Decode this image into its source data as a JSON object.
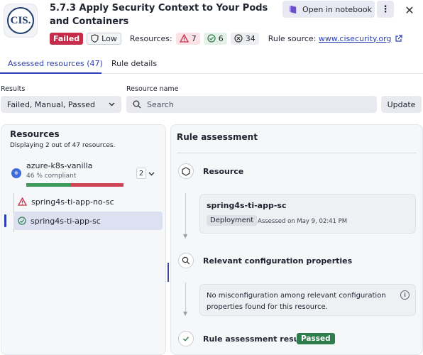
{
  "header": {
    "logo_text": "CIS.",
    "title": "5.7.3 Apply Security Context to Your Pods and Containers",
    "notebook_button": "Open in notebook",
    "more_button": "⋮",
    "close_button": "✕"
  },
  "meta": {
    "status": "Failed",
    "severity": "Low",
    "resources_label": "Resources:",
    "failed_count": "7",
    "passed_count": "6",
    "skipped_count": "34",
    "rule_source_label": "Rule source:",
    "rule_source_link": "www.cisecurity.org"
  },
  "tabs": [
    {
      "label": "Assessed resources (47)",
      "active": true
    },
    {
      "label": "Rule details",
      "active": false
    }
  ],
  "filters": {
    "results_label": "Results",
    "results_value": "Failed, Manual, Passed",
    "resource_name_label": "Resource name",
    "search_placeholder": "Search",
    "update_button": "Update"
  },
  "resources": {
    "title": "Resources",
    "subtitle": "Displaying 2 out of 47 resources.",
    "cluster": {
      "name": "azure-k8s-vanilla",
      "compliance_text": "46 % compliant",
      "compliance_fraction": 0.46,
      "count": "2"
    },
    "items": [
      {
        "name": "spring4s-ti-app-no-sc",
        "status": "failed",
        "selected": false
      },
      {
        "name": "spring4s-ti-app-sc",
        "status": "passed",
        "selected": true
      }
    ]
  },
  "assessment": {
    "title": "Rule assessment",
    "resource_step": "Resource",
    "resource_name": "spring4s-ti-app-sc",
    "resource_kind": "Deployment",
    "assessed_on": "Assessed on May 9, 02:41 PM",
    "config_step": "Relevant configuration properties",
    "config_message": "No misconfiguration among relevant configuration properties found for this resource.",
    "result_step": "Rule assessment result:",
    "result_value": "Passed"
  },
  "colors": {
    "accent": "#2c3fb4",
    "failed": "#c62c4a",
    "passed": "#2e7d4c"
  }
}
